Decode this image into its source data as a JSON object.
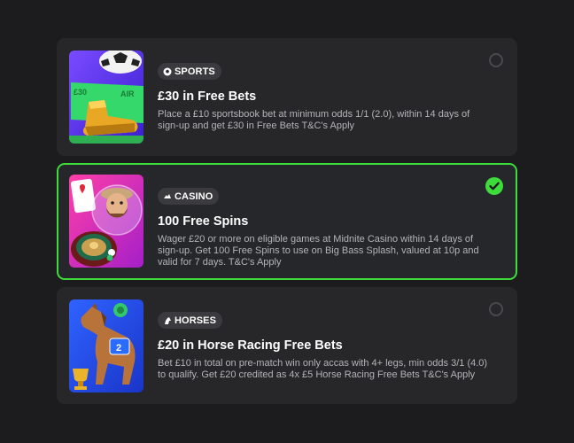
{
  "offers": [
    {
      "category": "SPORTS",
      "category_icon": "football-icon",
      "title": "£30 in Free Bets",
      "description": "Place a £10 sportsbook bet at minimum odds 1/1 (2.0), within 14 days of sign-up and get £30 in Free Bets T&C's Apply",
      "selected": false,
      "thumbnail_text": [
        "£30",
        "AIR"
      ]
    },
    {
      "category": "CASINO",
      "category_icon": "casino-chip-icon",
      "title": "100 Free Spins",
      "description": "Wager £20 or more on eligible games at Midnite Casino within 14 days of sign-up. Get 100 Free Spins to use on Big Bass Splash, valued at 10p and valid for 7 days. T&C's Apply",
      "selected": true
    },
    {
      "category": "HORSES",
      "category_icon": "horse-head-icon",
      "title": "£20 in Horse Racing Free Bets",
      "description": "Bet £10 in total on pre-match win only accas with 4+ legs, min odds 3/1 (4.0) to qualify. Get £20 credited as 4x £5 Horse Racing Free Bets T&C's Apply",
      "selected": false,
      "thumbnail_text": [
        "2"
      ]
    }
  ],
  "colors": {
    "accent_green": "#3ddc3a",
    "card_bg": "#27272a",
    "page_bg": "#1c1c1e"
  }
}
